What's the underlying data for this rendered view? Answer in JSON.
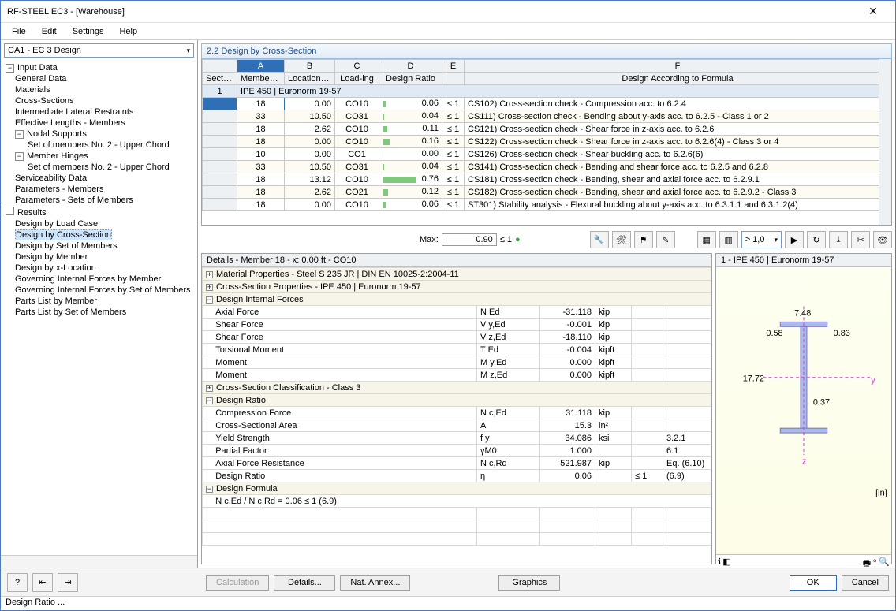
{
  "window": {
    "title": "RF-STEEL EC3 - [Warehouse]",
    "close": "✕"
  },
  "menu": [
    "File",
    "Edit",
    "Settings",
    "Help"
  ],
  "nav_combo": "CA1 - EC 3 Design",
  "tree": {
    "input": "Input Data",
    "input_items": [
      "General Data",
      "Materials",
      "Cross-Sections",
      "Intermediate Lateral Restraints",
      "Effective Lengths - Members"
    ],
    "nodal": "Nodal Supports",
    "nodal_items": [
      "Set of members No. 2 - Upper Chord"
    ],
    "hinges": "Member Hinges",
    "hinges_items": [
      "Set of members No. 2 - Upper Chord"
    ],
    "after_hinges": [
      "Serviceability Data",
      "Parameters - Members",
      "Parameters - Sets of Members"
    ],
    "results": "Results",
    "results_items": [
      "Design by Load Case",
      "Design by Cross-Section",
      "Design by Set of Members",
      "Design by Member",
      "Design by x-Location",
      "Governing Internal Forces by Member",
      "Governing Internal Forces by Set of Members",
      "Parts List by Member",
      "Parts List by Set of Members"
    ],
    "selected": "Design by Cross-Section"
  },
  "panel_title": "2.2 Design by Cross-Section",
  "grid": {
    "letters": [
      "",
      "A",
      "B",
      "C",
      "D",
      "E",
      "F"
    ],
    "headers": [
      "Section No.",
      "Member No.",
      "Location x [ft]",
      "Load-ing",
      "Design Ratio",
      "",
      "Design According to Formula"
    ],
    "section_row": {
      "no": "1",
      "label": "IPE 450 | Euronorm 19-57"
    },
    "rows": [
      {
        "m": "18",
        "x": "0.00",
        "l": "CO10",
        "r": "0.06",
        "bar": 0.06,
        "c": "≤ 1",
        "d": "CS102) Cross-section check - Compression acc. to 6.2.4"
      },
      {
        "m": "33",
        "x": "10.50",
        "l": "CO31",
        "r": "0.04",
        "bar": 0.04,
        "c": "≤ 1",
        "d": "CS111) Cross-section check - Bending about y-axis acc. to 6.2.5 - Class 1 or 2"
      },
      {
        "m": "18",
        "x": "2.62",
        "l": "CO10",
        "r": "0.11",
        "bar": 0.11,
        "c": "≤ 1",
        "d": "CS121) Cross-section check - Shear force in z-axis acc. to 6.2.6"
      },
      {
        "m": "18",
        "x": "0.00",
        "l": "CO10",
        "r": "0.16",
        "bar": 0.16,
        "c": "≤ 1",
        "d": "CS122) Cross-section check - Shear force in z-axis acc. to 6.2.6(4) - Class 3 or 4"
      },
      {
        "m": "10",
        "x": "0.00",
        "l": "CO1",
        "r": "0.00",
        "bar": 0.0,
        "c": "≤ 1",
        "d": "CS126) Cross-section check - Shear buckling acc. to 6.2.6(6)"
      },
      {
        "m": "33",
        "x": "10.50",
        "l": "CO31",
        "r": "0.04",
        "bar": 0.04,
        "c": "≤ 1",
        "d": "CS141) Cross-section check - Bending and shear force acc. to 6.2.5 and 6.2.8"
      },
      {
        "m": "18",
        "x": "13.12",
        "l": "CO10",
        "r": "0.76",
        "bar": 0.76,
        "c": "≤ 1",
        "d": "CS181) Cross-section check - Bending, shear and axial force acc. to 6.2.9.1"
      },
      {
        "m": "18",
        "x": "2.62",
        "l": "CO21",
        "r": "0.12",
        "bar": 0.12,
        "c": "≤ 1",
        "d": "CS182) Cross-section check - Bending, shear and axial force acc. to 6.2.9.2 - Class 3"
      },
      {
        "m": "18",
        "x": "0.00",
        "l": "CO10",
        "r": "0.06",
        "bar": 0.06,
        "c": "≤ 1",
        "d": "ST301) Stability analysis - Flexural buckling about y-axis acc. to 6.3.1.1 and 6.3.1.2(4)"
      }
    ]
  },
  "maxbar": {
    "label": "Max:",
    "value": "0.90",
    "cond": "≤ 1"
  },
  "filter_combo": "> 1,0",
  "details": {
    "header": "Details - Member 18 - x: 0.00 ft - CO10",
    "mat": "Material Properties - Steel S 235 JR | DIN EN 10025-2:2004-11",
    "cs": "Cross-Section Properties  -  IPE 450 | Euronorm 19-57",
    "dif": "Design Internal Forces",
    "forces": [
      {
        "n": "Axial Force",
        "s": "N Ed",
        "v": "-31.118",
        "u": "kip"
      },
      {
        "n": "Shear Force",
        "s": "V y,Ed",
        "v": "-0.001",
        "u": "kip"
      },
      {
        "n": "Shear Force",
        "s": "V z,Ed",
        "v": "-18.110",
        "u": "kip"
      },
      {
        "n": "Torsional Moment",
        "s": "T Ed",
        "v": "-0.004",
        "u": "kipft"
      },
      {
        "n": "Moment",
        "s": "M y,Ed",
        "v": "0.000",
        "u": "kipft"
      },
      {
        "n": "Moment",
        "s": "M z,Ed",
        "v": "0.000",
        "u": "kipft"
      }
    ],
    "csc": "Cross-Section Classification - Class 3",
    "dr": "Design Ratio",
    "ratios": [
      {
        "n": "Compression Force",
        "s": "N c,Ed",
        "v": "31.118",
        "u": "kip",
        "c": "",
        "r": ""
      },
      {
        "n": "Cross-Sectional Area",
        "s": "A",
        "v": "15.3",
        "u": "in²",
        "c": "",
        "r": ""
      },
      {
        "n": "Yield Strength",
        "s": "f y",
        "v": "34.086",
        "u": "ksi",
        "c": "",
        "r": "3.2.1"
      },
      {
        "n": "Partial Factor",
        "s": "γM0",
        "v": "1.000",
        "u": "",
        "c": "",
        "r": "6.1"
      },
      {
        "n": "Axial Force Resistance",
        "s": "N c,Rd",
        "v": "521.987",
        "u": "kip",
        "c": "",
        "r": "Eq. (6.10)"
      },
      {
        "n": "Design Ratio",
        "s": "η",
        "v": "0.06",
        "u": "",
        "c": "≤ 1",
        "r": "(6.9)"
      }
    ],
    "df": "Design Formula",
    "formula": "N c,Ed / N c,Rd = 0.06 ≤ 1   (6.9)"
  },
  "preview": {
    "title": "1 - IPE 450 | Euronorm 19-57",
    "unit": "[in]",
    "dims": {
      "w": "7.48",
      "h": "17.72",
      "tf": "0.58",
      "tw": "0.37",
      "ofs": "0.83"
    }
  },
  "footer": {
    "calc": "Calculation",
    "details": "Details...",
    "annex": "Nat. Annex...",
    "graphics": "Graphics",
    "ok": "OK",
    "cancel": "Cancel"
  },
  "status": "Design Ratio ..."
}
